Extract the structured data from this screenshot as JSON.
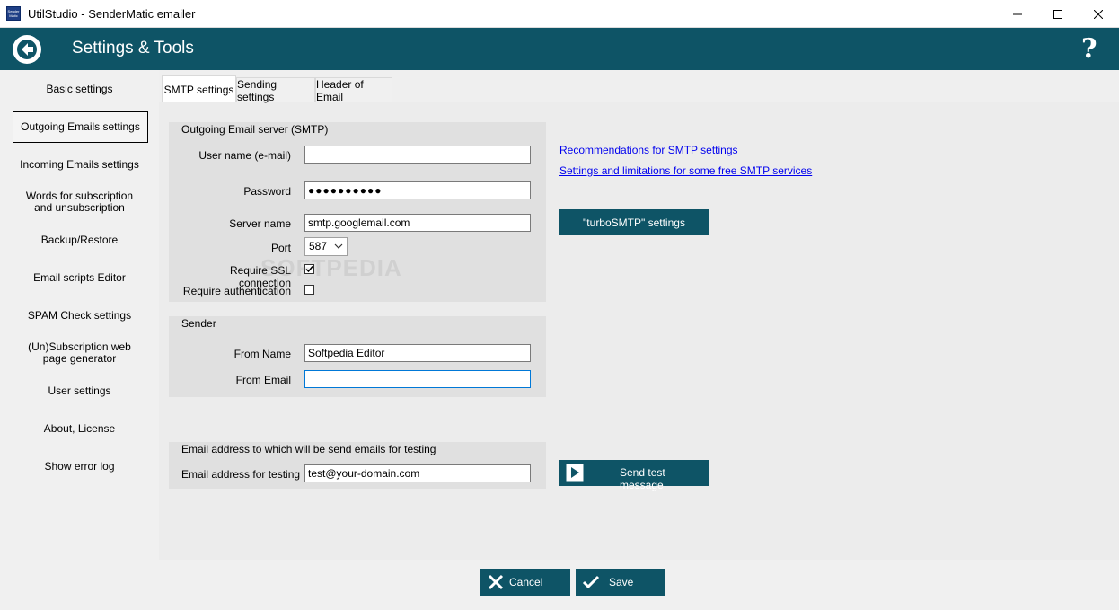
{
  "window": {
    "title": "UtilStudio - SenderMatic emailer",
    "app_icon_text": "Sender Matic"
  },
  "header": {
    "title": "Settings & Tools",
    "help": "?"
  },
  "sidebar": {
    "items": [
      {
        "label": "Basic settings"
      },
      {
        "label": "Outgoing Emails settings"
      },
      {
        "label": "Incoming Emails settings"
      },
      {
        "label": "Words for subscription and unsubscription"
      },
      {
        "label": "Backup/Restore"
      },
      {
        "label": "Email scripts Editor"
      },
      {
        "label": "SPAM Check settings"
      },
      {
        "label": "(Un)Subscription web page generator"
      },
      {
        "label": "User settings"
      },
      {
        "label": "About, License"
      },
      {
        "label": "Show error log"
      }
    ],
    "active_index": 1
  },
  "tabs": [
    {
      "label": "SMTP settings",
      "active": true
    },
    {
      "label": "Sending settings",
      "active": false
    },
    {
      "label": "Header of Email",
      "active": false
    }
  ],
  "smtp_group": {
    "title": "Outgoing Email server (SMTP)",
    "username_label": "User name (e-mail)",
    "username_value": "",
    "password_label": "Password",
    "password_value": "●●●●●●●●●●",
    "server_label": "Server name",
    "server_value": "smtp.googlemail.com",
    "port_label": "Port",
    "port_value": "587",
    "ssl_label": "Require SSL connection",
    "ssl_checked": true,
    "auth_label": "Require authentication",
    "auth_checked": false
  },
  "sender_group": {
    "title": "Sender",
    "from_name_label": "From Name",
    "from_name_value": "Softpedia Editor",
    "from_email_label": "From Email",
    "from_email_value": ""
  },
  "test_group": {
    "title": "Email address to which will be send emails for testing",
    "address_label": "Email address for testing",
    "address_value": "test@your-domain.com"
  },
  "links": {
    "recommendations": "Recommendations for SMTP settings",
    "limitations": "Settings and limitations for some free SMTP services"
  },
  "buttons": {
    "turbo": "\"turboSMTP\" settings",
    "send_test": "Send test message",
    "cancel": "Cancel",
    "save": "Save"
  },
  "watermark": "SOFTPEDIA",
  "colors": {
    "accent": "#0e5466",
    "link": "#0000ee"
  }
}
